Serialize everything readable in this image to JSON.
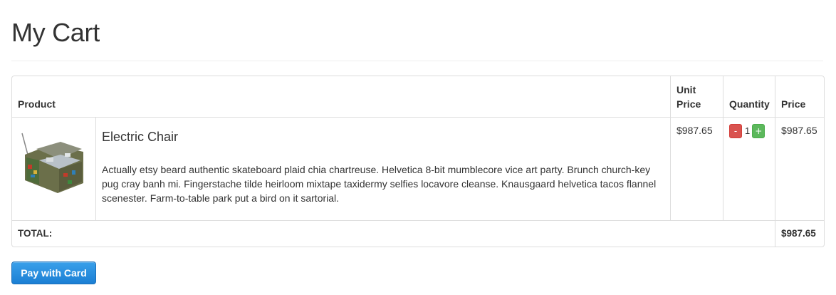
{
  "page": {
    "title": "My Cart"
  },
  "table": {
    "headers": {
      "product": "Product",
      "unit_price": "Unit Price",
      "quantity": "Quantity",
      "price": "Price"
    },
    "items": [
      {
        "image_icon": "electric-chair-photo",
        "name": "Electric Chair",
        "description": "Actually etsy beard authentic skateboard plaid chia chartreuse. Helvetica 8-bit mumblecore vice art party. Brunch church-key pug cray banh mi. Fingerstache tilde heirloom mixtape taxidermy selfies locavore cleanse. Knausgaard helvetica tacos flannel scenester. Farm-to-table park put a bird on it sartorial.",
        "unit_price": "$987.65",
        "quantity": "1",
        "price": "$987.65",
        "minus_label": "-",
        "plus_label": "+"
      }
    ],
    "footer": {
      "total_label": "TOTAL:",
      "total_value": "$987.65"
    }
  },
  "actions": {
    "pay_label": "Pay with Card"
  },
  "colors": {
    "decrease": "#d9534f",
    "increase": "#5cb85c",
    "pay_button": "#2a8fde"
  }
}
